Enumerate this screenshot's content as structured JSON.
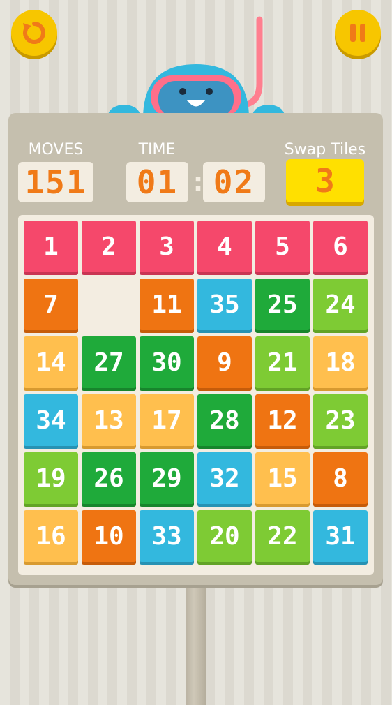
{
  "hud": {
    "moves_label": "MOVES",
    "moves_value": "151",
    "time_label": "TIME",
    "time_minutes": "01",
    "time_seconds": "02",
    "time_separator": ":",
    "swap_label": "Swap Tiles",
    "swap_value": "3"
  },
  "buttons": {
    "restart_icon": "restart-icon",
    "pause_icon": "pause-icon"
  },
  "colors": {
    "pink": "#f5486b",
    "orange": "#ef7412",
    "blue": "#33b8de",
    "green": "#1faa3a",
    "lime": "#7ecb34",
    "yellow": "#ffbf4e",
    "accent": "#f7c600"
  },
  "grid": {
    "rows": 6,
    "cols": 6,
    "tiles": [
      {
        "v": "1",
        "c": "pink"
      },
      {
        "v": "2",
        "c": "pink"
      },
      {
        "v": "3",
        "c": "pink"
      },
      {
        "v": "4",
        "c": "pink"
      },
      {
        "v": "5",
        "c": "pink"
      },
      {
        "v": "6",
        "c": "pink"
      },
      {
        "v": "7",
        "c": "orange"
      },
      null,
      {
        "v": "11",
        "c": "orange"
      },
      {
        "v": "35",
        "c": "blue"
      },
      {
        "v": "25",
        "c": "green"
      },
      {
        "v": "24",
        "c": "lime"
      },
      {
        "v": "14",
        "c": "yellow"
      },
      {
        "v": "27",
        "c": "green"
      },
      {
        "v": "30",
        "c": "green"
      },
      {
        "v": "9",
        "c": "orange"
      },
      {
        "v": "21",
        "c": "lime"
      },
      {
        "v": "18",
        "c": "yellow"
      },
      {
        "v": "34",
        "c": "blue"
      },
      {
        "v": "13",
        "c": "yellow"
      },
      {
        "v": "17",
        "c": "yellow"
      },
      {
        "v": "28",
        "c": "green"
      },
      {
        "v": "12",
        "c": "orange"
      },
      {
        "v": "23",
        "c": "lime"
      },
      {
        "v": "19",
        "c": "lime"
      },
      {
        "v": "26",
        "c": "green"
      },
      {
        "v": "29",
        "c": "green"
      },
      {
        "v": "32",
        "c": "blue"
      },
      {
        "v": "15",
        "c": "yellow"
      },
      {
        "v": "8",
        "c": "orange"
      },
      {
        "v": "16",
        "c": "yellow"
      },
      {
        "v": "10",
        "c": "orange"
      },
      {
        "v": "33",
        "c": "blue"
      },
      {
        "v": "20",
        "c": "lime"
      },
      {
        "v": "22",
        "c": "lime"
      },
      {
        "v": "31",
        "c": "blue"
      }
    ]
  }
}
